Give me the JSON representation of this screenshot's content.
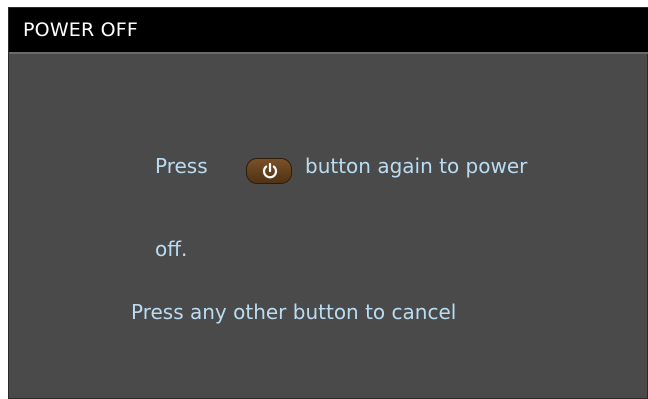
{
  "dialog": {
    "title": "POWER OFF",
    "line1_before": "Press",
    "line1_after": "button again to power",
    "line2": "off.",
    "line3": "Press any other button to cancel",
    "icon": "power-icon",
    "colors": {
      "title_bar": "#000000",
      "background": "#4a4a4a",
      "message_text": "#b9dcf2",
      "power_button": "#6b4520"
    }
  }
}
